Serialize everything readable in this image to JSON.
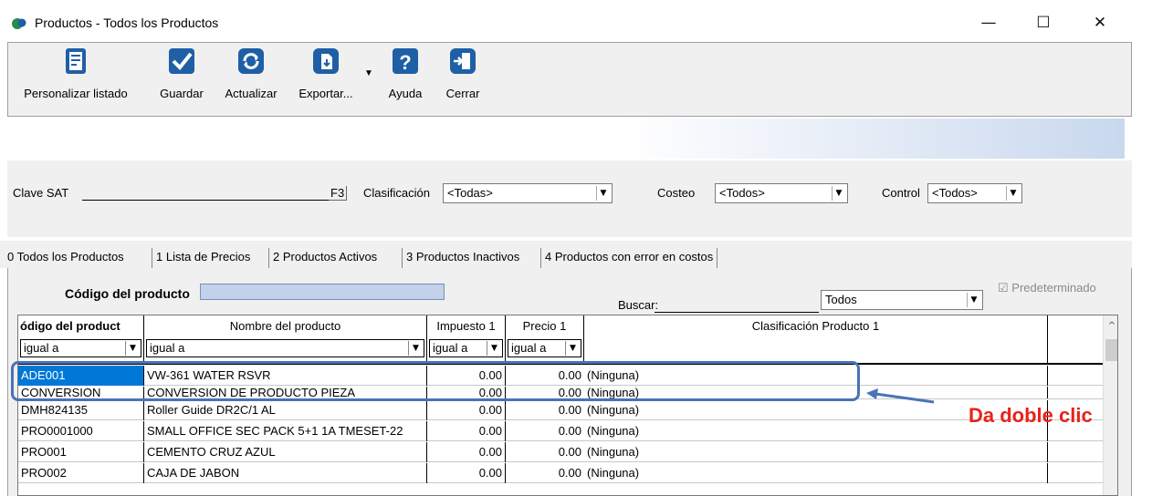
{
  "window": {
    "title": "Productos - Todos los Productos",
    "minimize": "—",
    "maximize": "☐",
    "close": "✕"
  },
  "toolbar": {
    "personalizar": "Personalizar listado",
    "guardar": "Guardar",
    "actualizar": "Actualizar",
    "exportar": "Exportar...",
    "exportar_dropdown": "▼",
    "ayuda": "Ayuda",
    "cerrar": "Cerrar"
  },
  "filters": {
    "clave_sat_label": "Clave SAT",
    "clave_sat_hotkey": "F3",
    "clasificacion_label": "Clasificación",
    "clasificacion_value": "<Todas>",
    "costeo_label": "Costeo",
    "costeo_value": "<Todos>",
    "control_label": "Control",
    "control_value": "<Todos>"
  },
  "tabs": [
    {
      "label": "0 Todos los Productos"
    },
    {
      "label": "1 Lista de Precios"
    },
    {
      "label": "2 Productos Activos"
    },
    {
      "label": "3 Productos Inactivos"
    },
    {
      "label": "4 Productos con error en costos"
    }
  ],
  "panel": {
    "code_label": "Código del producto",
    "search_label": "Buscar:",
    "search_scope": "Todos",
    "predeterminado": "Predeterminado",
    "predeterminado_check": "☑"
  },
  "grid": {
    "columns": [
      {
        "header": "ódigo del product",
        "filter": "igual a"
      },
      {
        "header": "Nombre del producto",
        "filter": "igual a"
      },
      {
        "header": "Impuesto 1",
        "filter": "igual a"
      },
      {
        "header": "Precio 1",
        "filter": "igual a"
      },
      {
        "header": "Clasificación Producto 1",
        "filter": ""
      }
    ],
    "rows": [
      {
        "code": "ADE001",
        "name": "VW-361 WATER RSVR",
        "tax": "0.00",
        "price": "0.00",
        "class": "(Ninguna)",
        "selected": true
      },
      {
        "code": "CONVERSION",
        "name": "CONVERSION DE PRODUCTO PIEZA",
        "tax": "0.00",
        "price": "0.00",
        "class": "(Ninguna)"
      },
      {
        "code": "DMH824135",
        "name": "Roller Guide DR2C/1 AL",
        "tax": "0.00",
        "price": "0.00",
        "class": "(Ninguna)"
      },
      {
        "code": "PRO0001000",
        "name": "SMALL OFFICE SEC PACK 5+1 1A TMESET-22",
        "tax": "0.00",
        "price": "0.00",
        "class": "(Ninguna)"
      },
      {
        "code": "PRO001",
        "name": "CEMENTO CRUZ AZUL",
        "tax": "0.00",
        "price": "0.00",
        "class": "(Ninguna)"
      },
      {
        "code": "PRO002",
        "name": "CAJA DE JABON",
        "tax": "0.00",
        "price": "0.00",
        "class": "(Ninguna)"
      }
    ]
  },
  "annotation": {
    "text": "Da doble clic",
    "color": "#e8231a",
    "box_color": "#4a72b8"
  }
}
